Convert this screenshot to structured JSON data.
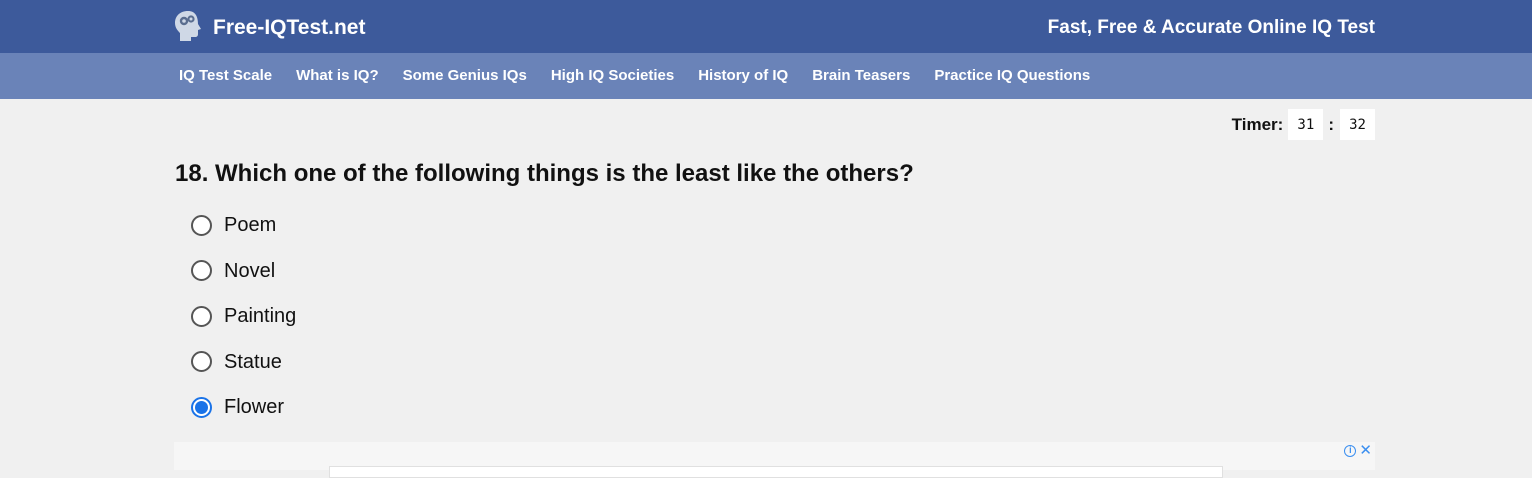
{
  "header": {
    "site_name": "Free-IQTest.net",
    "tagline": "Fast, Free & Accurate Online IQ Test",
    "logo_icon": "brain-head-icon",
    "bg_color": "#3d5a9b"
  },
  "nav": {
    "bg_color": "#6a83b8",
    "items": [
      {
        "label": "IQ Test Scale"
      },
      {
        "label": "What is IQ?"
      },
      {
        "label": "Some Genius IQs"
      },
      {
        "label": "High IQ Societies"
      },
      {
        "label": "History of IQ"
      },
      {
        "label": "Brain Teasers"
      },
      {
        "label": "Practice IQ Questions"
      }
    ]
  },
  "timer": {
    "label": "Timer:",
    "minutes": "31",
    "separator": ":",
    "seconds": "32"
  },
  "question": {
    "text": "18. Which one of the following things is the least like the others?",
    "options": [
      {
        "label": "Poem",
        "selected": false
      },
      {
        "label": "Novel",
        "selected": false
      },
      {
        "label": "Painting",
        "selected": false
      },
      {
        "label": "Statue",
        "selected": false
      },
      {
        "label": "Flower",
        "selected": true
      }
    ],
    "accent_color": "#1a73e8"
  },
  "ad": {
    "info_icon": "info-icon",
    "close_icon": "close-icon"
  }
}
